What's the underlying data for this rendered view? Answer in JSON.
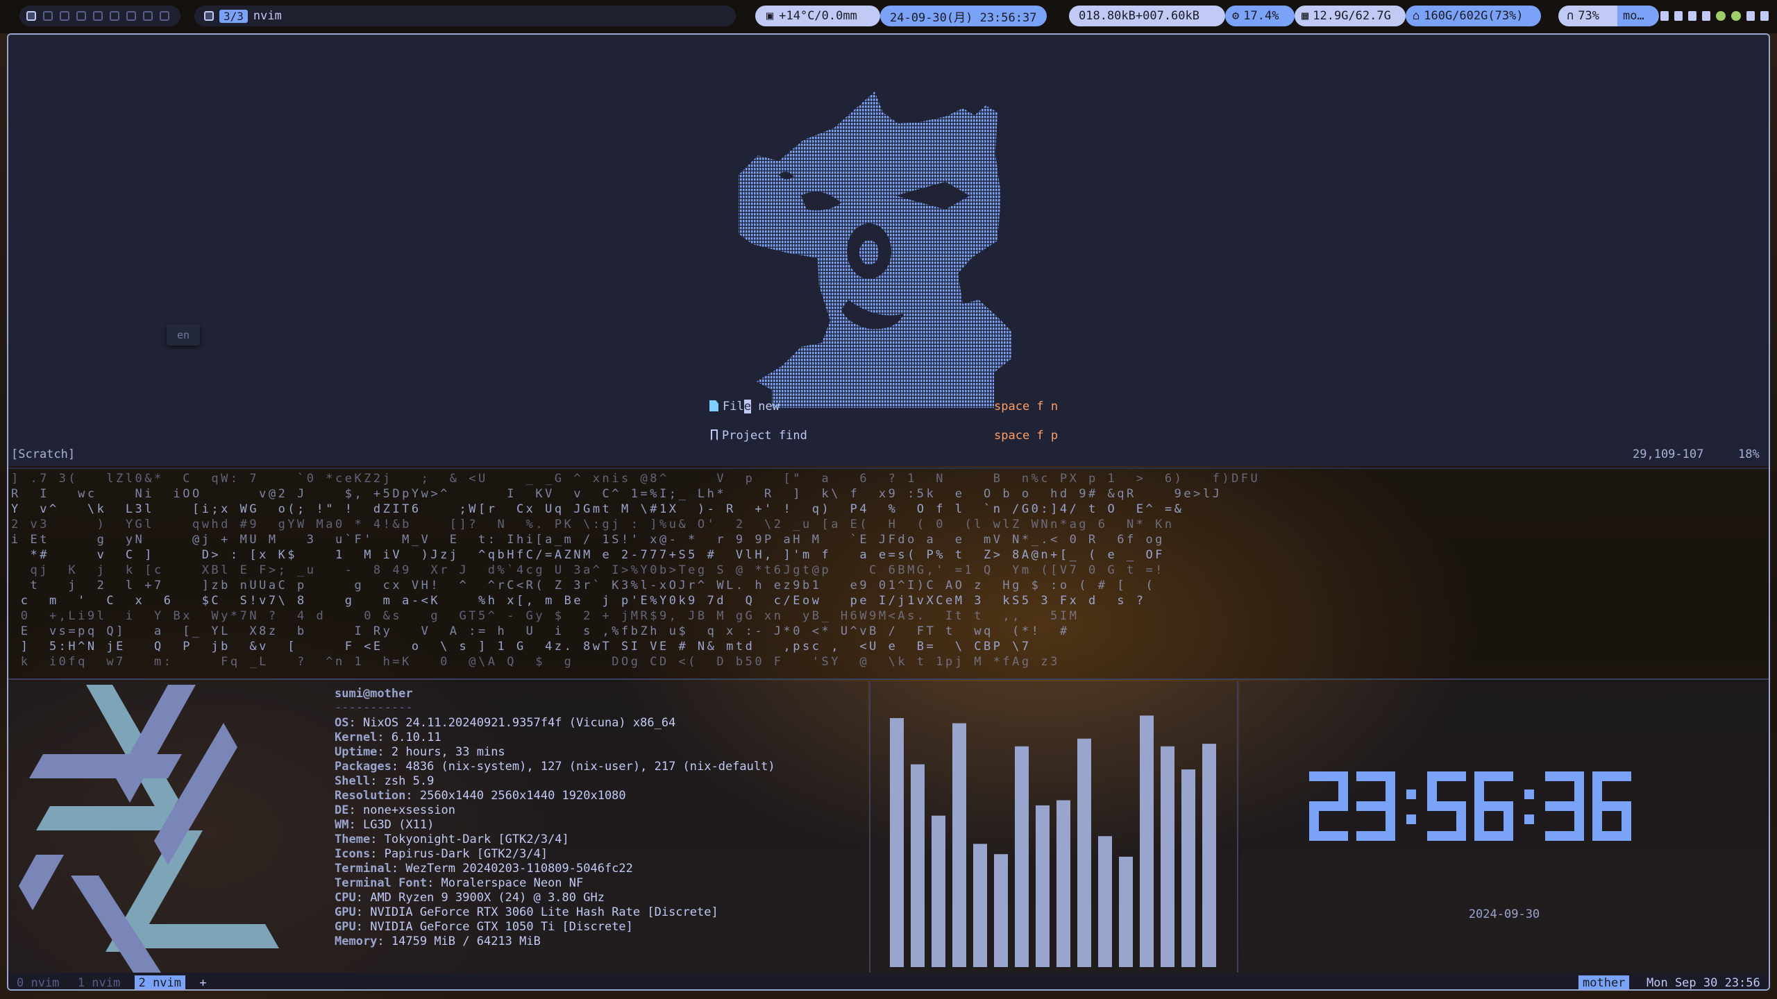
{
  "topbar": {
    "window_tag": "3/3",
    "window_title": "nvim",
    "weather": "+14°C/0.0mm",
    "datetime": "24-09-30(月) 23:56:37",
    "network": "018.80kB+007.60kB",
    "cpu": "17.4%",
    "memory": "12.9G/62.7G",
    "disk": "160G/602G(73%)",
    "volume": "73%",
    "title_short": "mo…",
    "icons": [
      "workspace-icon",
      "weather-icon",
      "cpu-icon",
      "memory-icon",
      "disk-icon",
      "headphones-icon",
      "battery-icon",
      "bluetooth-icon",
      "network-icon",
      "status-icon",
      "display-icon",
      "power-icon"
    ]
  },
  "nvim": {
    "dashboard": [
      {
        "label_pre": "Fil",
        "label_cursor": "e",
        "label_post": " new",
        "key": "space f n",
        "icon": "file-icon"
      },
      {
        "label": "Project find",
        "key": "space f p",
        "icon": "bookmark-icon"
      }
    ],
    "float_hint": "en",
    "status": {
      "buffer": "[Scratch]",
      "position": "29,109-107",
      "percent": "18%"
    }
  },
  "matrix": [
    "] .7 3(   lZl0&*  C  qW: 7    `0 *ceKZ2j   ;  & <U    _ _G ^ xnis @8^     V  p   [\"  a   6  ? 1  N     B  n%c PX p 1  >  6)   f)DFU",
    "R  I   wc    Ni  iOO      v@2 J    $, +5DpYw>^      I  KV  v  C^ 1=%I;_ Lh*    R  ]  k\\ f  x9 :5k  e  O b o  hd 9# &qR    9e>lJ",
    "Y  v^   \\k  L3l    [i;x WG  o(; !\" !  dZIT6    ;W[r  Cx Uq JGmt M \\#1X  )- R  +' !  q)  P4  %  O f l  `n /G0:]4/ t O  E^ =&",
    "2 v3     )  YGl    qwhd #9  gYW Ma0 * 4!&b    []?  N  %. PK \\:gj : ]%u& O'  2  \\2 _u [a E(  H  ( 0  (l wlZ WNn*ag 6  N* Kn",
    "i Et     g  yN     @j + MU M   3  u`F'   M_V  E  t: Ihi[a_m / 1S!' x@- *  r 9 9P aH M   `E JFdo a  e  mV N*_.< 0 R  6f og",
    "  *#     v  C ]     D> : [x K$    1  M iV  )Jzj  ^qbHfC/=AZNM e 2-777+S5 #  VlH, ]'m f   a e=s( P% t  Z> 8A@n+[_ ( e _ OF",
    "  qj  K  j  k [c    XBl E F>; _u   -  8 49  Xr J  d%`4cg U 3a^ I>%Y0b>Teg S @ *t6Jgt@p    C 6BMG,' =1 Q  Ym ([V7 0 G t =!",
    "  t   j  2  l +7    ]zb nUUaC p     g  cx VH!  ^  ^rC<R( Z 3r` K3%l-xOJr^ WL. h ez9b1   e9 01^I)C AO z  Hg $ :o ( # [  (",
    " c  m  '  C  x  6   $C  S!v7\\ 8    g   m a-<K    %h x[, m Be  j p'E%Y0k9 7d  Q  c/Eow   pe I/j1vXCeM 3  kS5 3 Fx d  s ?",
    " 0  +,Li9l  i  Y Bx  Wy*7N ?  4 d    0 &s   g  GT5^ - Gy $  2 + jMR$9, JB M gG xn  yB_ H6W9M<As.  It t  ,,   5IM",
    " E  vs=pq Q]   a  [_ YL  X8z  b     I Ry   V  A := h  U  i  s ,%fbZh u$  q x :- J*0 <* U^vB /  FT t  wq  (*!  #",
    " ]  5:H^N jE   Q  P  jb  &v  [     F <E   o  \\ s ] 1 G  4z. 8wT SI VE # N& mtd   ,psc ,  <U e  B=  \\ CBP \\7",
    " k  i0fq  w7   m:     Fq _L   ?  ^n 1  h=K   0  @\\A Q  $  g    DOg CD <(  D b50 F   'SY  @  \\k t 1pj M *fAg z3"
  ],
  "fetch": {
    "user_host": "sumi@mother",
    "separator": "-----------",
    "lines": [
      {
        "k": "OS",
        "v": "NixOS 24.11.20240921.9357f4f (Vicuna) x86_64"
      },
      {
        "k": "Kernel",
        "v": "6.10.11"
      },
      {
        "k": "Uptime",
        "v": "2 hours, 33 mins"
      },
      {
        "k": "Packages",
        "v": "4836 (nix-system), 127 (nix-user), 217 (nix-default)"
      },
      {
        "k": "Shell",
        "v": "zsh 5.9"
      },
      {
        "k": "Resolution",
        "v": "2560x1440 2560x1440 1920x1080"
      },
      {
        "k": "DE",
        "v": "none+xsession"
      },
      {
        "k": "WM",
        "v": "LG3D (X11)"
      },
      {
        "k": "Theme",
        "v": "Tokyonight-Dark [GTK2/3/4]"
      },
      {
        "k": "Icons",
        "v": "Papirus-Dark [GTK2/3/4]"
      },
      {
        "k": "Terminal",
        "v": "WezTerm 20240203-110809-5046fc22"
      },
      {
        "k": "Terminal Font",
        "v": "Moralerspace Neon NF"
      },
      {
        "k": "CPU",
        "v": "AMD Ryzen 9 3900X (24) @ 3.80 GHz"
      },
      {
        "k": "GPU",
        "v": "NVIDIA GeForce RTX 3060 Lite Hash Rate [Discrete]"
      },
      {
        "k": "GPU",
        "v": "NVIDIA GeForce GTX 1050 Ti [Discrete]"
      },
      {
        "k": "Memory",
        "v": "14759 MiB / 64213 MiB"
      }
    ]
  },
  "cava": {
    "levels": [
      0.97,
      0.79,
      0.59,
      0.95,
      0.48,
      0.44,
      0.86,
      0.63,
      0.65,
      0.89,
      0.51,
      0.43,
      0.98,
      0.86,
      0.77,
      0.87
    ]
  },
  "clock": {
    "time": "23:56:36",
    "date": "2024-09-30"
  },
  "colors": {
    "bar": "#9aa5ce",
    "accent": "#7aa2f7",
    "clock": "#7aa2f7",
    "flake_light": "#7ea4b8",
    "flake_dark": "#7b86b8"
  },
  "tmux": {
    "windows": [
      "0 nvim",
      "1 nvim",
      "2 nvim"
    ],
    "active": 2,
    "plus": "+",
    "host": "mother",
    "datetime": "Mon Sep 30 23:56"
  }
}
